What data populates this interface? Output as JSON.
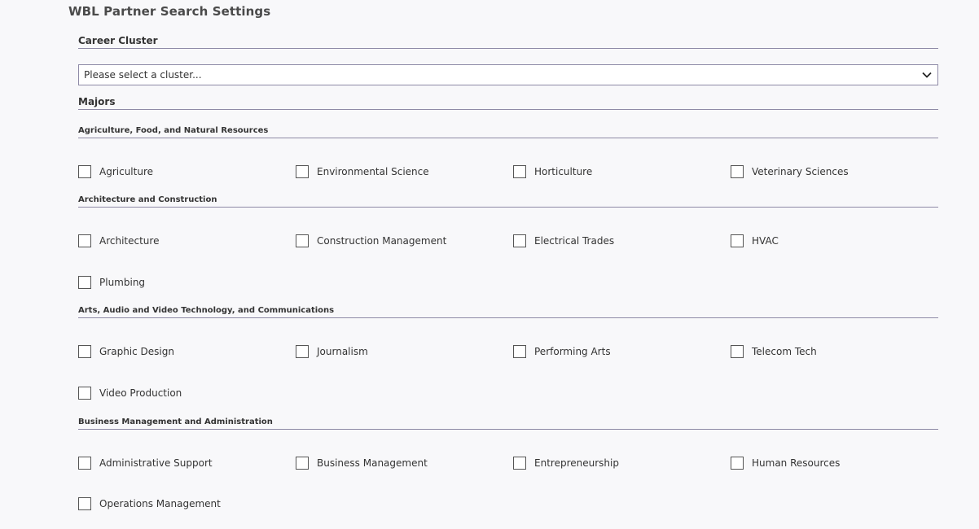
{
  "header": {
    "title": "WBL Partner Search Settings"
  },
  "career_cluster": {
    "label": "Career Cluster",
    "select_value": "Please select a cluster...",
    "icon": "chevron-down-icon"
  },
  "majors": {
    "label": "Majors",
    "groups": [
      {
        "title": "Agriculture, Food, and Natural Resources",
        "items": [
          "Agriculture",
          "Environmental Science",
          "Horticulture",
          "Veterinary Sciences"
        ]
      },
      {
        "title": "Architecture and Construction",
        "items": [
          "Architecture",
          "Construction Management",
          "Electrical Trades",
          "HVAC",
          "Plumbing"
        ]
      },
      {
        "title": "Arts, Audio and Video Technology, and Communications",
        "items": [
          "Graphic Design",
          "Journalism",
          "Performing Arts",
          "Telecom Tech",
          "Video Production"
        ]
      },
      {
        "title": "Business Management and Administration",
        "items": [
          "Administrative Support",
          "Business Management",
          "Entrepreneurship",
          "Human Resources",
          "Operations Management"
        ]
      }
    ]
  }
}
